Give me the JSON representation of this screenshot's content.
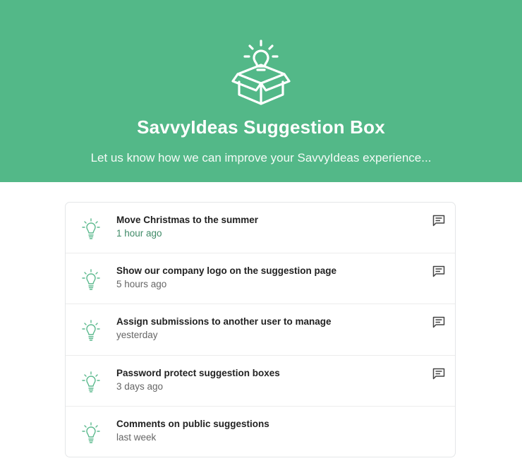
{
  "header": {
    "title": "SavvyIdeas Suggestion Box",
    "subtitle": "Let us know how we can improve your SavvyIdeas experience...",
    "background_color": "#53b888",
    "icon": "lightbulb-box-icon"
  },
  "suggestions": [
    {
      "title": "Move Christmas to the summer",
      "time": "1 hour ago",
      "has_comments": true
    },
    {
      "title": "Show our company logo on the suggestion page",
      "time": "5 hours ago",
      "has_comments": true
    },
    {
      "title": "Assign submissions to another user to manage",
      "time": "yesterday",
      "has_comments": true
    },
    {
      "title": "Password protect suggestion boxes",
      "time": "3 days ago",
      "has_comments": true
    },
    {
      "title": "Comments on public suggestions",
      "time": "last week",
      "has_comments": false
    }
  ],
  "icons": {
    "item": "lightbulb-icon",
    "comment": "comment-icon"
  },
  "colors": {
    "accent": "#53b888",
    "recent_time": "#3f8a67"
  }
}
